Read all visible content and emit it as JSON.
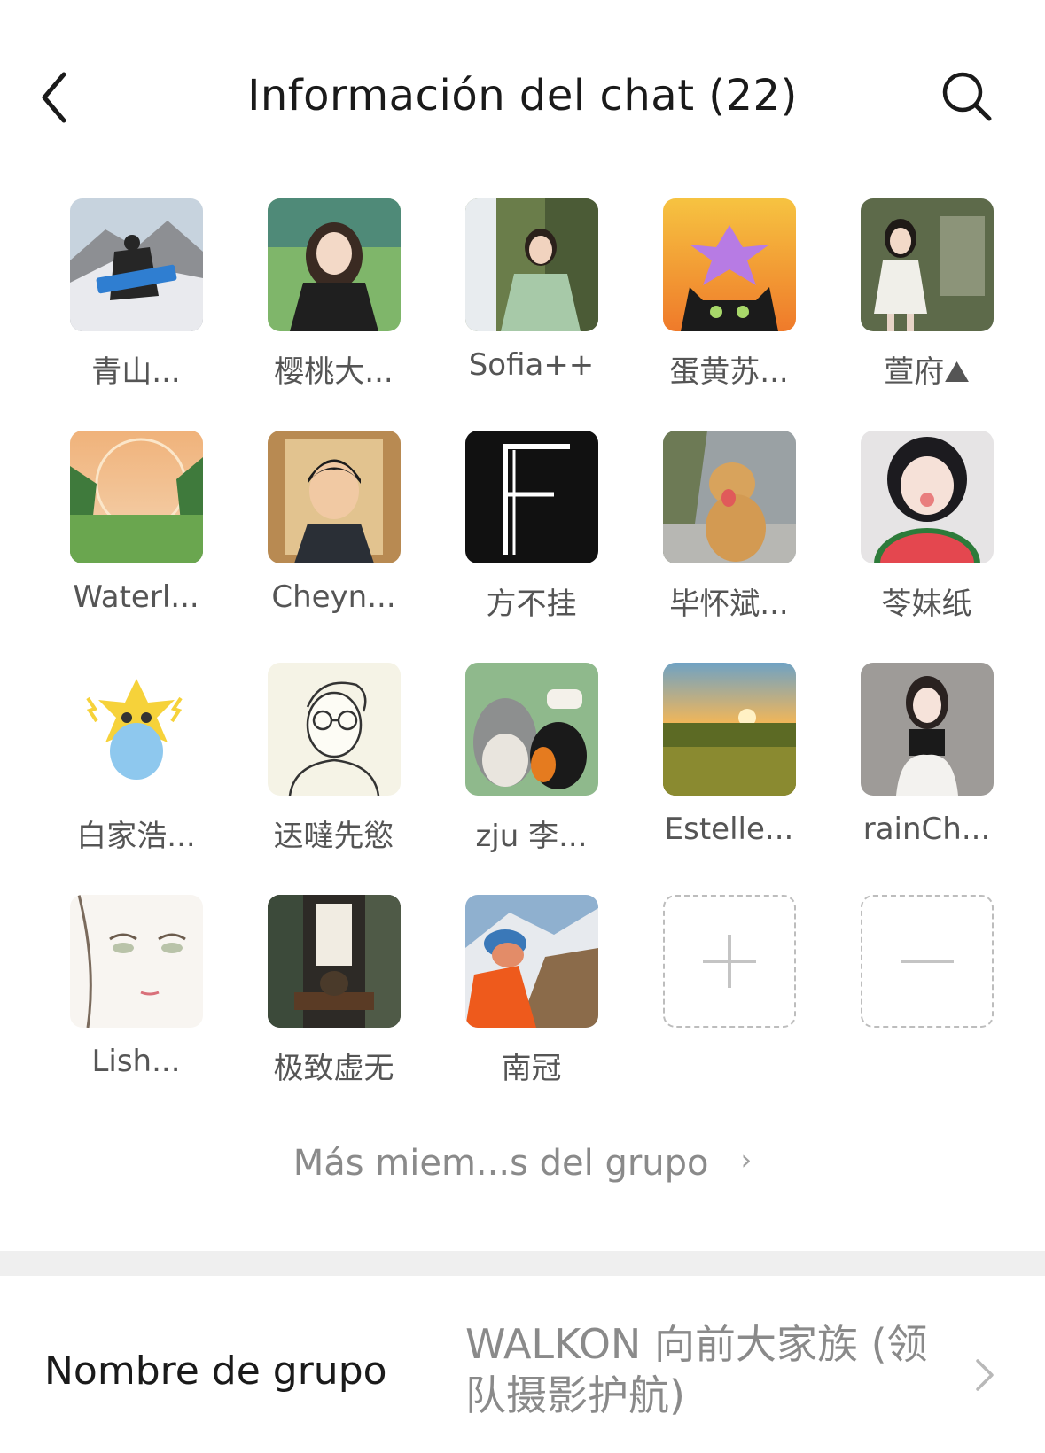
{
  "header": {
    "title": "Información del chat (22)",
    "back_icon": "chevron-left-icon",
    "search_icon": "search-icon"
  },
  "members": [
    {
      "name": "青山...",
      "avatar": "mountain-hiker"
    },
    {
      "name": "樱桃大...",
      "avatar": "girl-meadow"
    },
    {
      "name": "Sofia++",
      "avatar": "girl-green-dress"
    },
    {
      "name": "蛋黄苏...",
      "avatar": "black-cat-flower"
    },
    {
      "name": "萱府⛰",
      "avatar": "girl-garden"
    },
    {
      "name": "Waterl...",
      "avatar": "green-valley"
    },
    {
      "name": "Cheyn...",
      "avatar": "cartoon-boy"
    },
    {
      "name": "方不挂",
      "avatar": "letter-f"
    },
    {
      "name": "毕怀斌...",
      "avatar": "golden-retriever"
    },
    {
      "name": "苓妹纸",
      "avatar": "girl-watermelon"
    },
    {
      "name": "白家浩...",
      "avatar": "blue-creature"
    },
    {
      "name": "迗噠先慾",
      "avatar": "glasses-sketch"
    },
    {
      "name": "zju 李...",
      "avatar": "birds"
    },
    {
      "name": "Estelle...",
      "avatar": "wheat-field"
    },
    {
      "name": "rainCh...",
      "avatar": "girl-black-top"
    },
    {
      "name": "Lish...",
      "avatar": "anime-face"
    },
    {
      "name": "极致虚无",
      "avatar": "tea-room"
    },
    {
      "name": "南冠",
      "avatar": "hiker-orange"
    }
  ],
  "actions": {
    "add_icon": "plus-icon",
    "remove_icon": "minus-icon"
  },
  "more_members": {
    "label": "Más miem...s del grupo",
    "chevron": "›"
  },
  "group_name": {
    "label": "Nombre de grupo",
    "value": "WALKON 向前大家族 (领队摄影护航)"
  },
  "colors": {
    "background": "#ffffff",
    "title_text": "#1a1a1a",
    "secondary_text": "#8a8a8a",
    "divider": "#efefef",
    "dashed_border": "#bdbdbd"
  }
}
